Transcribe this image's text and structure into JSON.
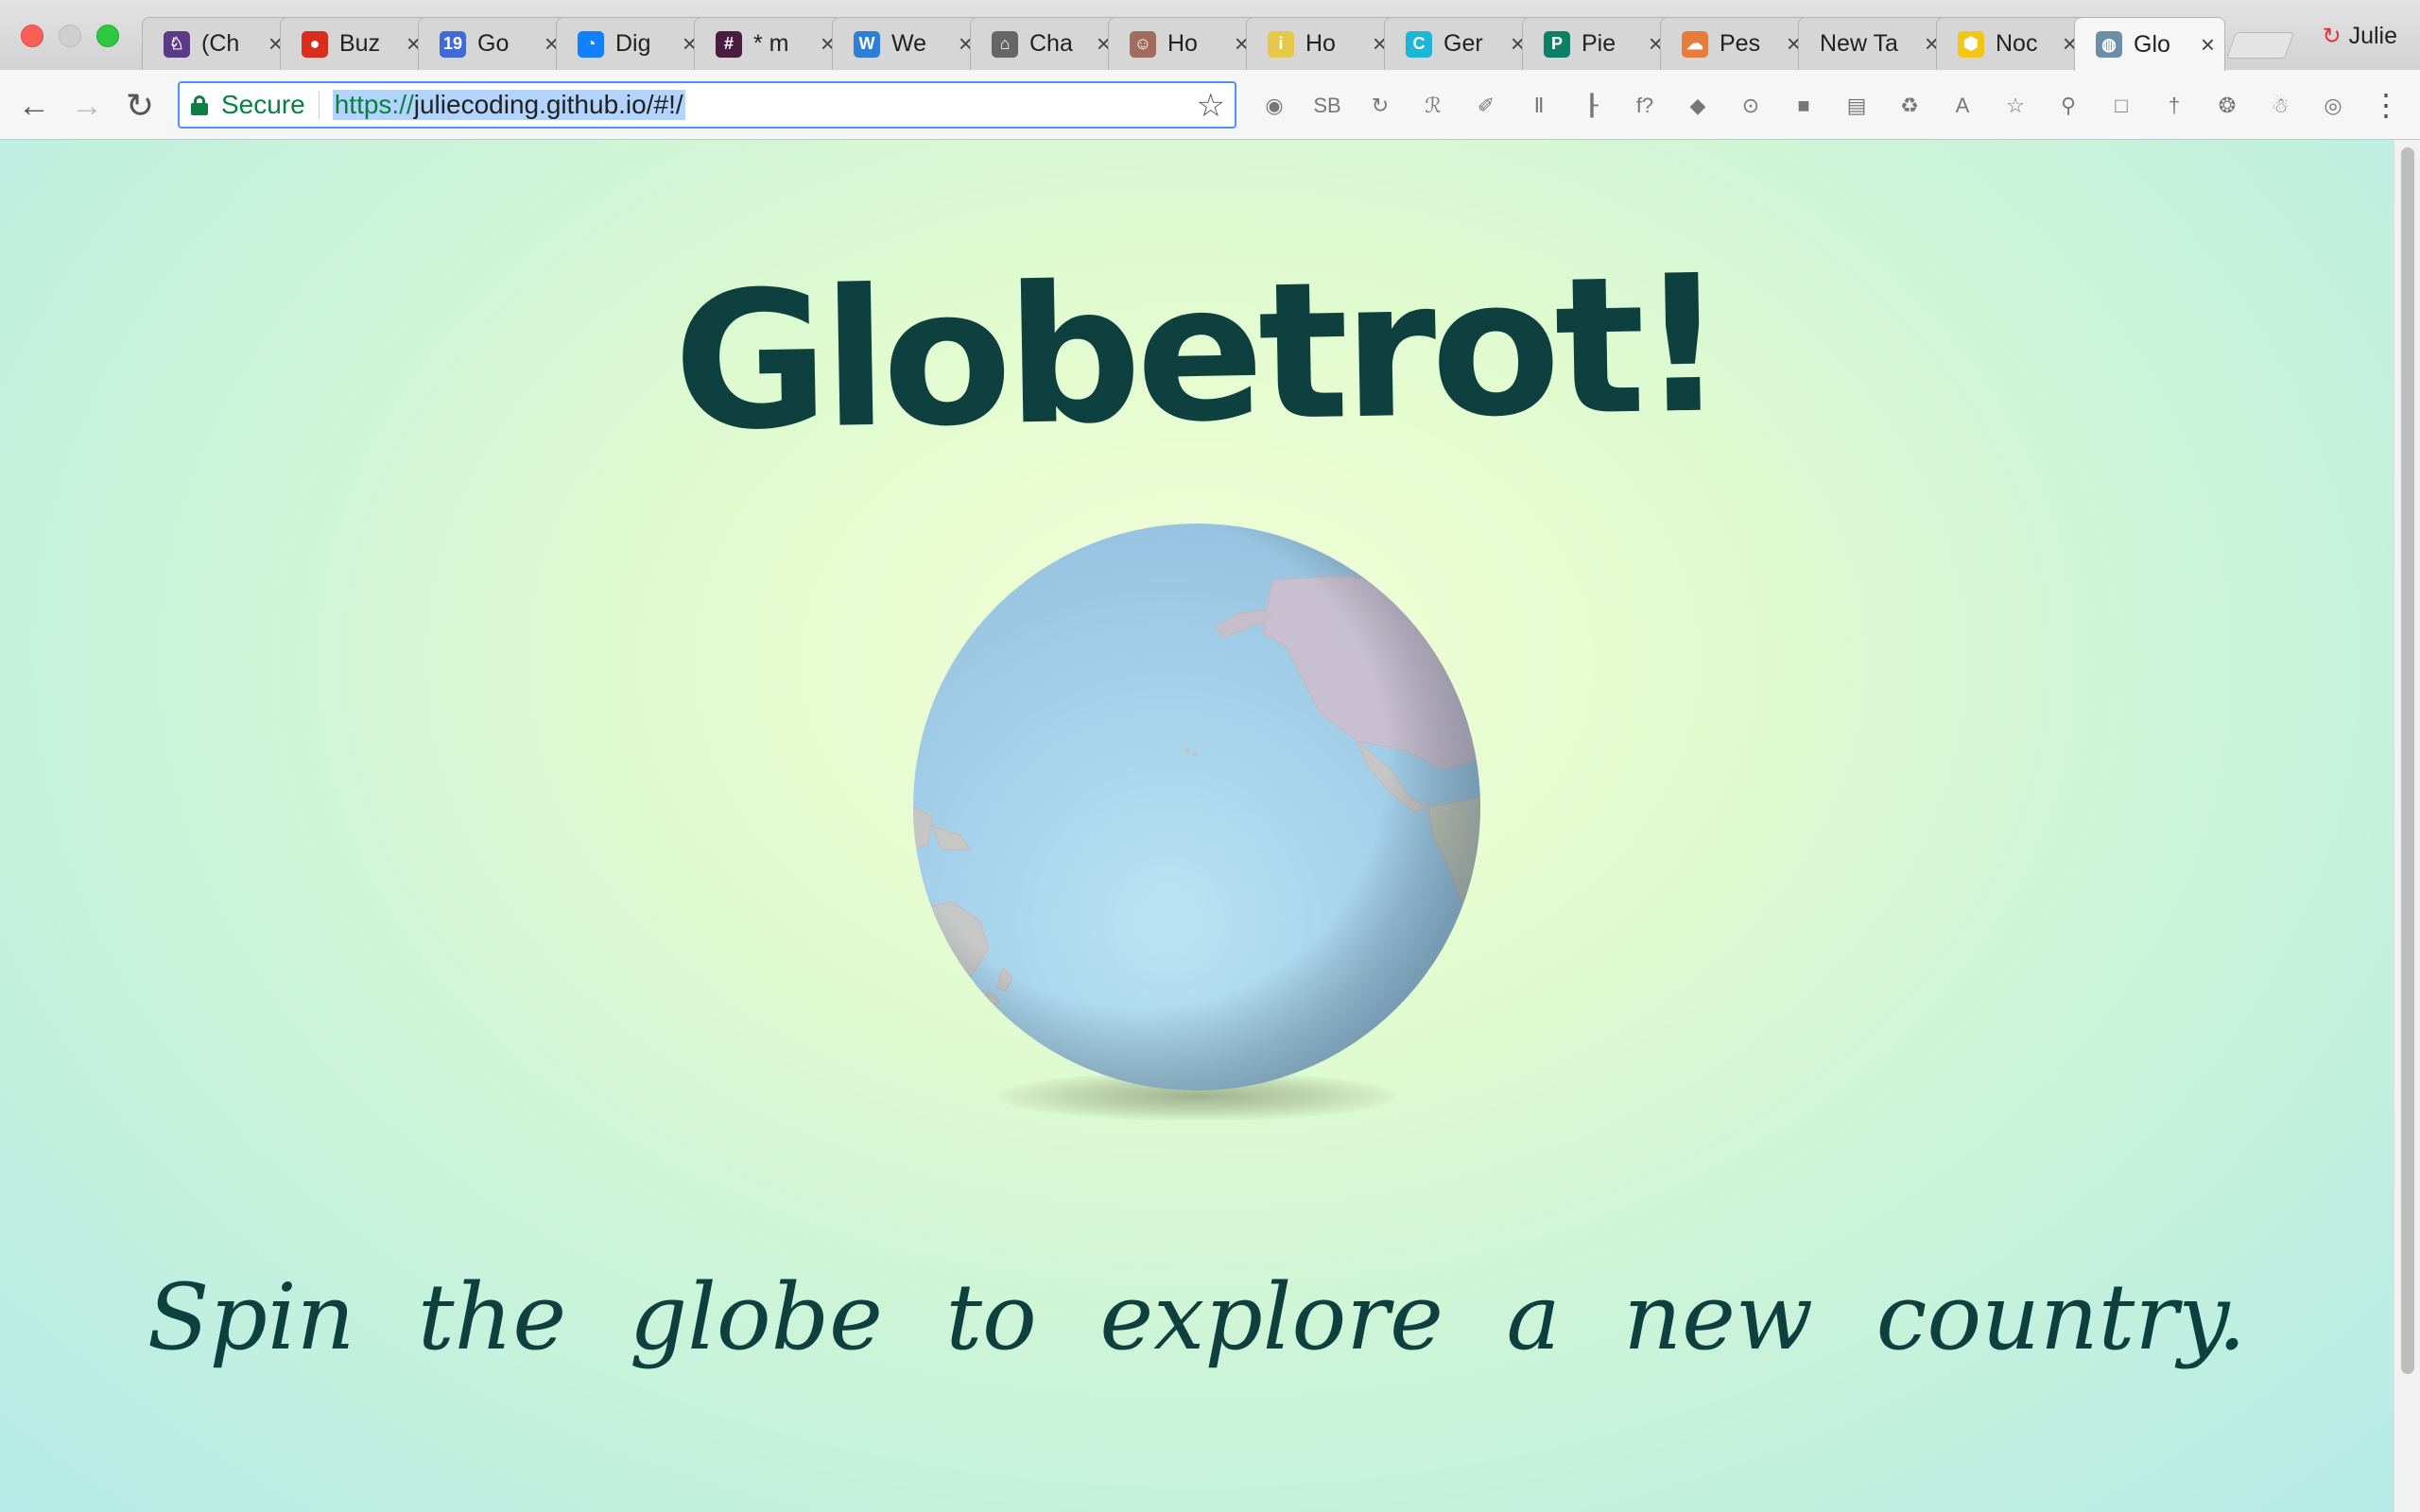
{
  "browser": {
    "tabs": [
      {
        "title": "(Ch",
        "favicon_color": "#5b3a8a",
        "favicon_glyph": "♘",
        "favicon_icon": "unicorn-icon",
        "left": 0
      },
      {
        "title": "Buz",
        "favicon_color": "#d92e1c",
        "favicon_glyph": "●",
        "favicon_icon": "tomato-icon"
      },
      {
        "title": "Go",
        "favicon_color": "#3f6ad8",
        "favicon_glyph": "19",
        "favicon_icon": "calendar-icon"
      },
      {
        "title": "Dig",
        "favicon_color": "#1080ff",
        "favicon_glyph": "◔",
        "favicon_icon": "digitalocean-icon"
      },
      {
        "title": "* m",
        "favicon_color": "#4a1c40",
        "favicon_glyph": "#",
        "favicon_icon": "slack-icon"
      },
      {
        "title": "We",
        "favicon_color": "#2f7fd6",
        "favicon_glyph": "W",
        "favicon_icon": "w-icon"
      },
      {
        "title": "Cha",
        "favicon_color": "#666666",
        "favicon_glyph": "⌂",
        "favicon_icon": "eye-icon"
      },
      {
        "title": "Ho",
        "favicon_color": "#a06d5c",
        "favicon_glyph": "☺",
        "favicon_icon": "avatar-icon"
      },
      {
        "title": "Ho",
        "favicon_color": "#e7c94a",
        "favicon_glyph": "i",
        "favicon_icon": "info-icon"
      },
      {
        "title": "Ger",
        "favicon_color": "#1db5d8",
        "favicon_glyph": "C",
        "favicon_icon": "c-logo-icon"
      },
      {
        "title": "Pie",
        "favicon_color": "#0d7f66",
        "favicon_glyph": "P",
        "favicon_icon": "p-logo-icon"
      },
      {
        "title": "Pes",
        "favicon_color": "#e87c3b",
        "favicon_glyph": "☁",
        "favicon_icon": "rainbow-icon"
      },
      {
        "title": "New Ta",
        "favicon_color": "",
        "favicon_glyph": "",
        "favicon_icon": ""
      },
      {
        "title": "Noc",
        "favicon_color": "#f3c614",
        "favicon_glyph": "⬢",
        "favicon_icon": "hexagon-icon"
      },
      {
        "title": "Glo",
        "favicon_color": "#6b8fa8",
        "favicon_glyph": "◍",
        "favicon_icon": "globe-icon",
        "active": true
      }
    ],
    "close_glyph": "×",
    "profile_name": "Julie",
    "secure_label": "Secure",
    "url_scheme": "https://",
    "url_rest": "juliecoding.github.io/#!/",
    "extensions": [
      "◉",
      "SB",
      "↻",
      "ℛ",
      "✐",
      "Ⅱ",
      "┠",
      "f?",
      "◆",
      "⊙",
      "■",
      "▤",
      "♻",
      "A",
      "☆",
      "⚲",
      "□",
      "†",
      "❂",
      "☃",
      "◎"
    ]
  },
  "page": {
    "title": "Globetrot!",
    "tagline": "Spin the globe to explore a new country."
  },
  "colors": {
    "ocean": "#a8d4ea",
    "land": "#c8c6c2",
    "title_ink": "#0f4040"
  }
}
